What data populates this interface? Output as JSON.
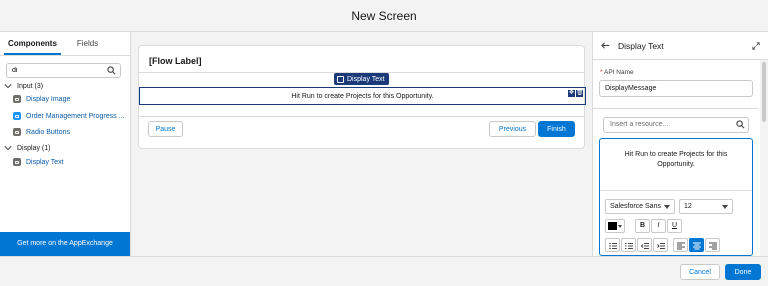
{
  "header": {
    "title": "New Screen"
  },
  "left_panel": {
    "tabs": [
      {
        "label": "Components"
      },
      {
        "label": "Fields"
      }
    ],
    "search": {
      "value": "di",
      "placeholder": ""
    },
    "groups": [
      {
        "label": "Input (3)",
        "items": [
          {
            "label": "Display Image",
            "icon": "image-icon",
            "color": "#706e6b"
          },
          {
            "label": "Order Management Progress ...",
            "icon": "progress-icon",
            "color": "#1b96ff"
          },
          {
            "label": "Radio Buttons",
            "icon": "radio-icon",
            "color": "#706e6b"
          }
        ]
      },
      {
        "label": "Display (1)",
        "items": [
          {
            "label": "Display Text",
            "icon": "text-icon",
            "color": "#706e6b"
          }
        ]
      }
    ],
    "appexchange_button": "Get more on the AppExchange"
  },
  "canvas": {
    "flow_label": "[Flow Label]",
    "selected_component_tag": "Display Text",
    "selected_text": "Hit Run to create Projects for this Opportunity.",
    "buttons": {
      "pause": "Pause",
      "previous": "Previous",
      "finish": "Finish"
    }
  },
  "properties_panel": {
    "title": "Display Text",
    "api_name": {
      "label": "API Name",
      "value": "DisplayMessage"
    },
    "resource_search": {
      "placeholder": "Insert a resource..."
    },
    "editor_text": "Hit Run to create Projects for this Opportunity.",
    "font_family": "Salesforce Sans",
    "font_size": "12",
    "format_buttons": {
      "bold": "B",
      "italic": "I",
      "underline": "U"
    }
  },
  "footer": {
    "cancel": "Cancel",
    "done": "Done"
  },
  "colors": {
    "brand": "#0176d3",
    "selection": "#1b3a7a",
    "background": "#f3f3f3"
  }
}
